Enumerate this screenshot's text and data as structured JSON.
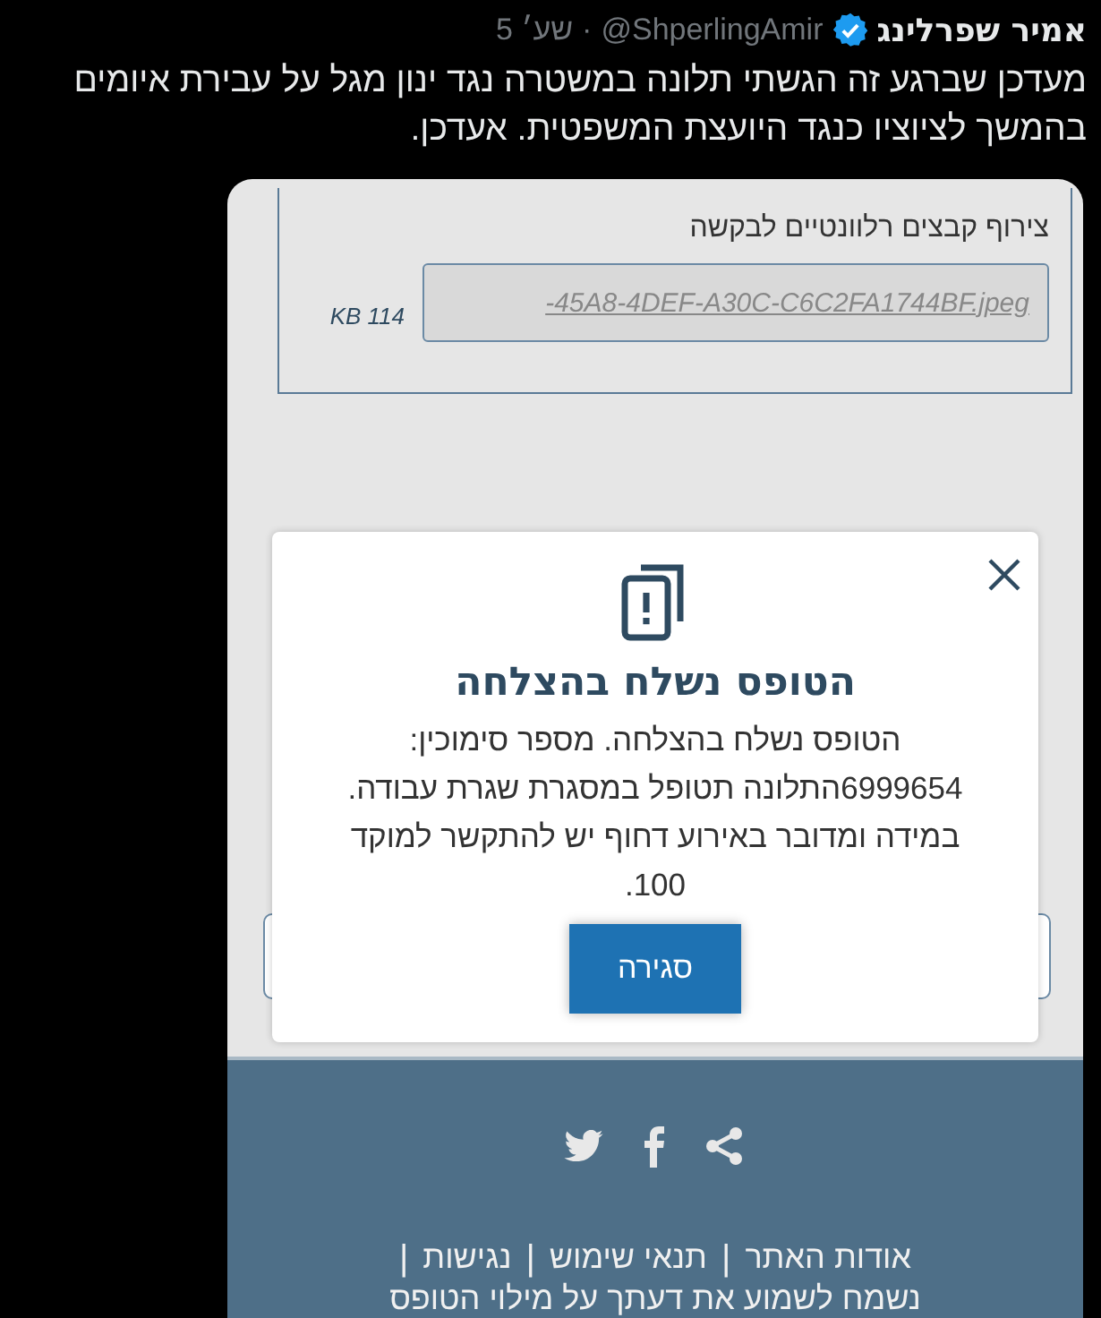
{
  "tweet": {
    "author": "אמיר שפרלינג",
    "verified": true,
    "handle": "@ShperlingAmir",
    "separator": "·",
    "time": "5 שע׳",
    "text": "מעדכן שברגע זה הגשתי תלונה במשטרה נגד ינון מגל על עבירת איומים בהמשך לציוציו כנגד היועצת המשפטית. אעדכן."
  },
  "form": {
    "attachments_label": "צירוף קבצים רלוונטיים לבקשה",
    "file_name": "-45A8-4DEF-A30C-C6C2FA1744BF.jpeg",
    "file_size": "KB 114"
  },
  "dialog": {
    "title": "הטופס נשלח בהצלחה",
    "message": "הטופס נשלח בהצלחה. מספר סימוכין: 6999654התלונה תטופל במסגרת שגרת עבודה. במידה ומדובר באירוע דחוף יש להתקשר למוקד 100.",
    "button": "סגירה"
  },
  "footer": {
    "links": [
      "אודות האתר",
      "תנאי שימוש",
      "נגישות"
    ],
    "separator": "|",
    "note": "נשמח לשמוע את דעתך על מילוי הטופס"
  }
}
